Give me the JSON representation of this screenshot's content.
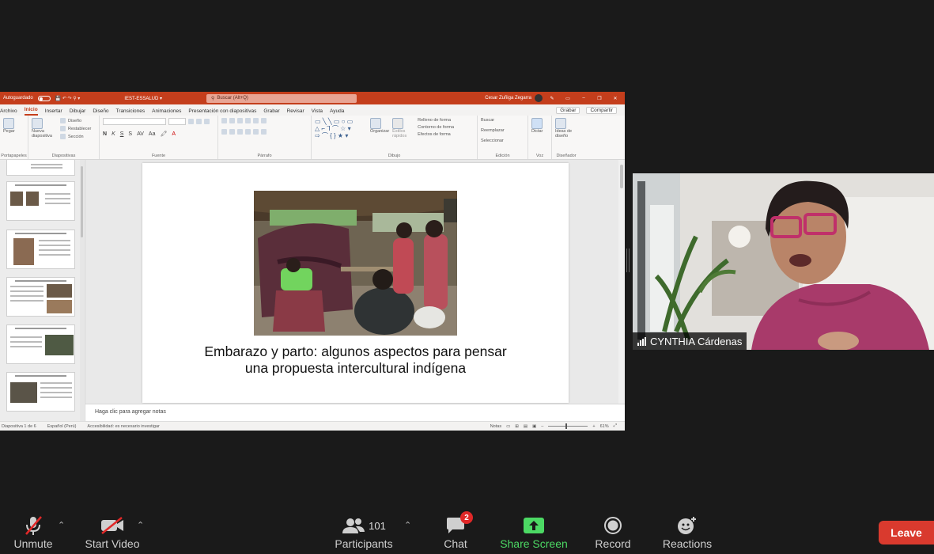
{
  "ppt": {
    "autosave": "Autoguardado",
    "doc_title": "IEST-ESSALUD ▾",
    "search": "Buscar (Alt+Q)",
    "user": "Cesar Zuñiga Zegarra",
    "tabs": [
      "Archivo",
      "Inicio",
      "Insertar",
      "Dibujar",
      "Diseño",
      "Transiciones",
      "Animaciones",
      "Presentación con diapositivas",
      "Grabar",
      "Revisar",
      "Vista",
      "Ayuda"
    ],
    "active_tab": "Inicio",
    "grabar": "Grabar",
    "compartir": "Compartir",
    "groups": {
      "portapapeles": "Portapapeles",
      "diapositivas": "Diapositivas",
      "fuente": "Fuente",
      "parrafo": "Párrafo",
      "dibujo": "Dibujo",
      "edicion": "Edición",
      "voz": "Voz",
      "disenador": "Diseñador"
    },
    "ribbon": {
      "pegar": "Pegar",
      "nueva": "Nueva diapositiva",
      "diseno": "Diseño",
      "restablecer": "Restablecer",
      "seccion": "Sección",
      "organizar": "Organizar",
      "estilos": "Estilos rápidos",
      "relleno": "Relleno de forma",
      "contorno": "Contorno de forma",
      "efectos": "Efectos de forma",
      "buscar": "Buscar",
      "reemplazar": "Reemplazar",
      "seleccionar": "Seleccionar",
      "dictar": "Dictar",
      "ideas": "Ideas de diseño"
    },
    "slide_title_line1": "Embarazo y parto: algunos aspectos para pensar",
    "slide_title_line2": "una propuesta intercultural indígena",
    "notes_placeholder": "Haga clic para agregar notas",
    "status": {
      "slide": "Diapositiva 1 de 6",
      "language": "Español (Perú)",
      "accessibility": "Accesibilidad: es necesario investigar",
      "notes": "Notas",
      "zoom": "61%"
    }
  },
  "participant": {
    "name": "CYNTHIA Cárdenas"
  },
  "toolbar": {
    "unmute": "Unmute",
    "start_video": "Start Video",
    "participants": "Participants",
    "participant_count": "101",
    "chat": "Chat",
    "chat_badge": "2",
    "share_screen": "Share Screen",
    "record": "Record",
    "reactions": "Reactions",
    "leave": "Leave"
  },
  "colors": {
    "ppt_accent": "#c43e1c",
    "share_green": "#4cd964",
    "leave_red": "#d93a2e",
    "badge_red": "#e02828"
  },
  "icons": [
    "microphone-muted-icon",
    "video-off-icon",
    "participants-icon",
    "chat-icon",
    "share-screen-icon",
    "record-icon",
    "reactions-icon",
    "signal-icon"
  ]
}
